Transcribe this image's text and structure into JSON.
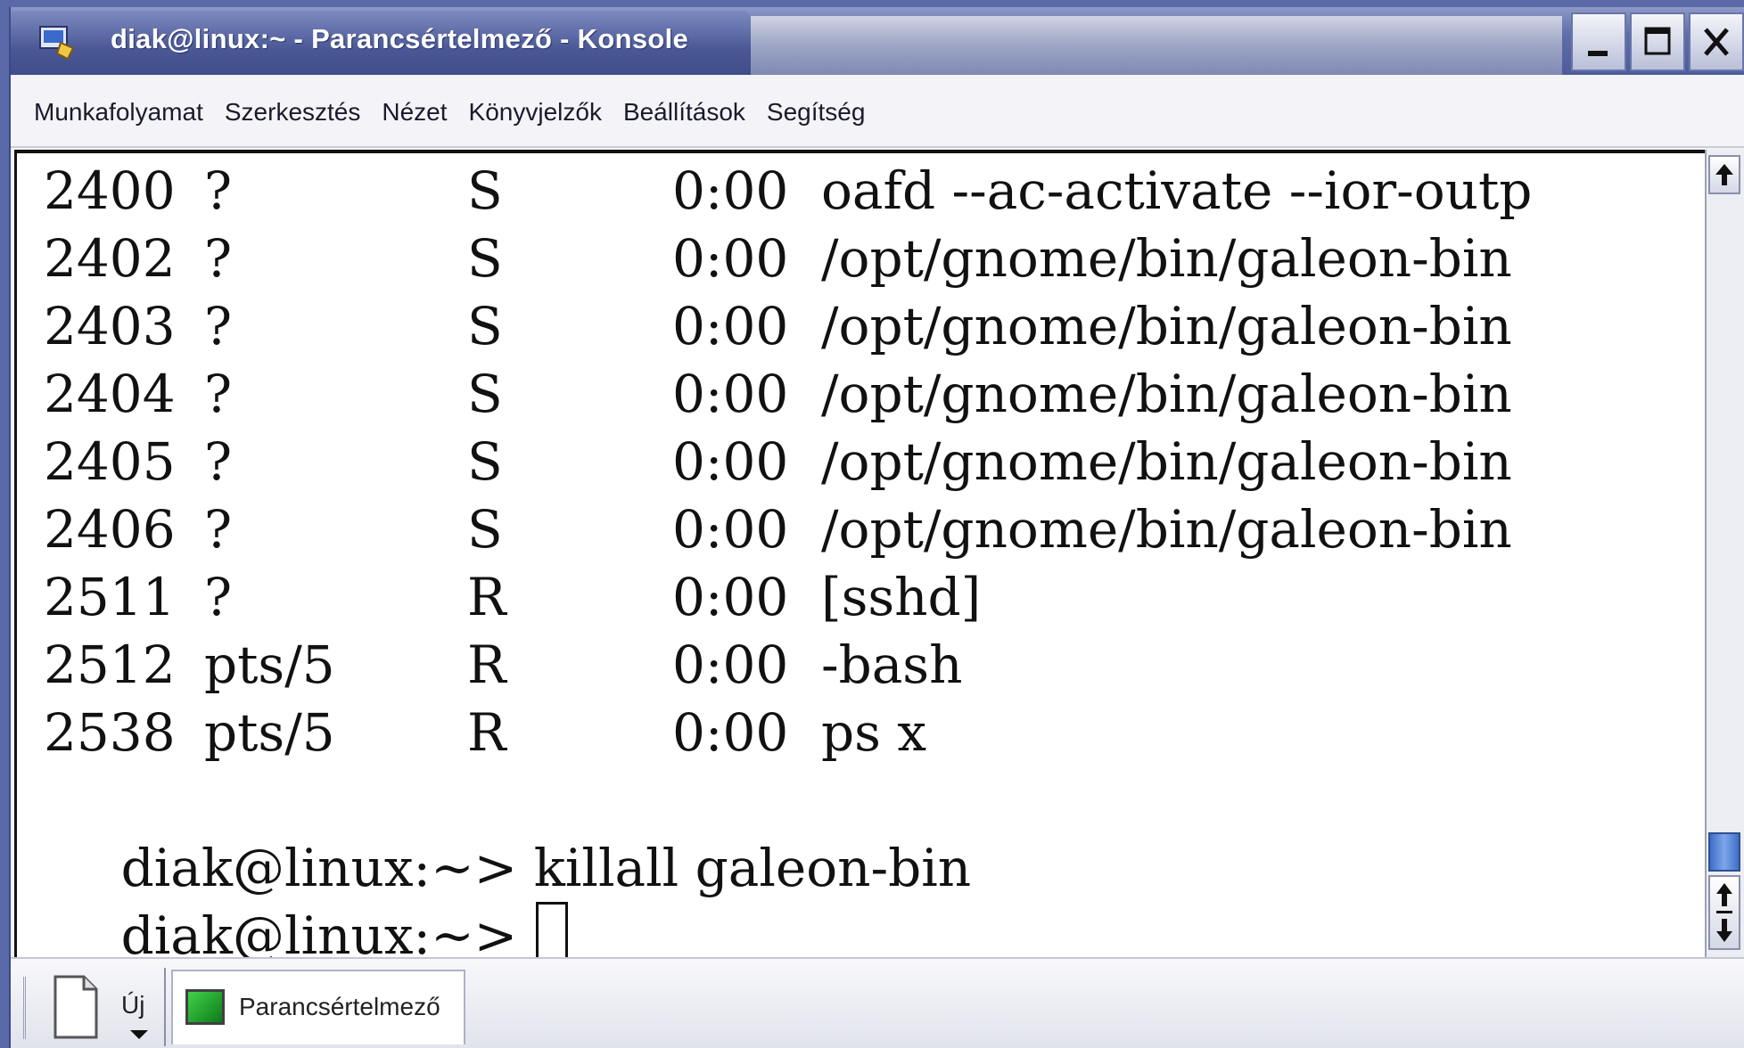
{
  "window": {
    "title": "diak@linux:~ - Parancsértelmező - Konsole"
  },
  "menu": {
    "items": [
      "Munkafolyamat",
      "Szerkesztés",
      "Nézet",
      "Könyvjelzők",
      "Beállítások",
      "Segítség"
    ]
  },
  "terminal": {
    "processes": [
      {
        "pid": "2400",
        "tty": "?",
        "stat": "S",
        "time": "0:00",
        "command": "oafd --ac-activate --ior-outp"
      },
      {
        "pid": "2402",
        "tty": "?",
        "stat": "S",
        "time": "0:00",
        "command": "/opt/gnome/bin/galeon-bin"
      },
      {
        "pid": "2403",
        "tty": "?",
        "stat": "S",
        "time": "0:00",
        "command": "/opt/gnome/bin/galeon-bin"
      },
      {
        "pid": "2404",
        "tty": "?",
        "stat": "S",
        "time": "0:00",
        "command": "/opt/gnome/bin/galeon-bin"
      },
      {
        "pid": "2405",
        "tty": "?",
        "stat": "S",
        "time": "0:00",
        "command": "/opt/gnome/bin/galeon-bin"
      },
      {
        "pid": "2406",
        "tty": "?",
        "stat": "S",
        "time": "0:00",
        "command": "/opt/gnome/bin/galeon-bin"
      },
      {
        "pid": "2511",
        "tty": "?",
        "stat": "R",
        "time": "0:00",
        "command": "[sshd]"
      },
      {
        "pid": "2512",
        "tty": "pts/5",
        "stat": "R",
        "time": "0:00",
        "command": "-bash"
      },
      {
        "pid": "2538",
        "tty": "pts/5",
        "stat": "R",
        "time": "0:00",
        "command": "ps x"
      }
    ],
    "prompt_lines": [
      "diak@linux:~> killall galeon-bin",
      "diak@linux:~> "
    ]
  },
  "taskbar": {
    "new_label": "Új",
    "session_label": "Parancsértelmező"
  },
  "colors": {
    "titlebar": "#4d5c99",
    "terminal_bg": "#ffffff",
    "terminal_fg": "#111111",
    "scroll_thumb": "#3e6fc8"
  },
  "icons": {
    "app": "konsole-icon",
    "minimize": "minimize-icon",
    "maximize": "maximize-icon",
    "close": "close-icon",
    "scroll_up": "arrow-up-icon",
    "scroll_step": "up-down-arrows-icon",
    "new_session": "new-document-icon",
    "session": "terminal-icon"
  }
}
